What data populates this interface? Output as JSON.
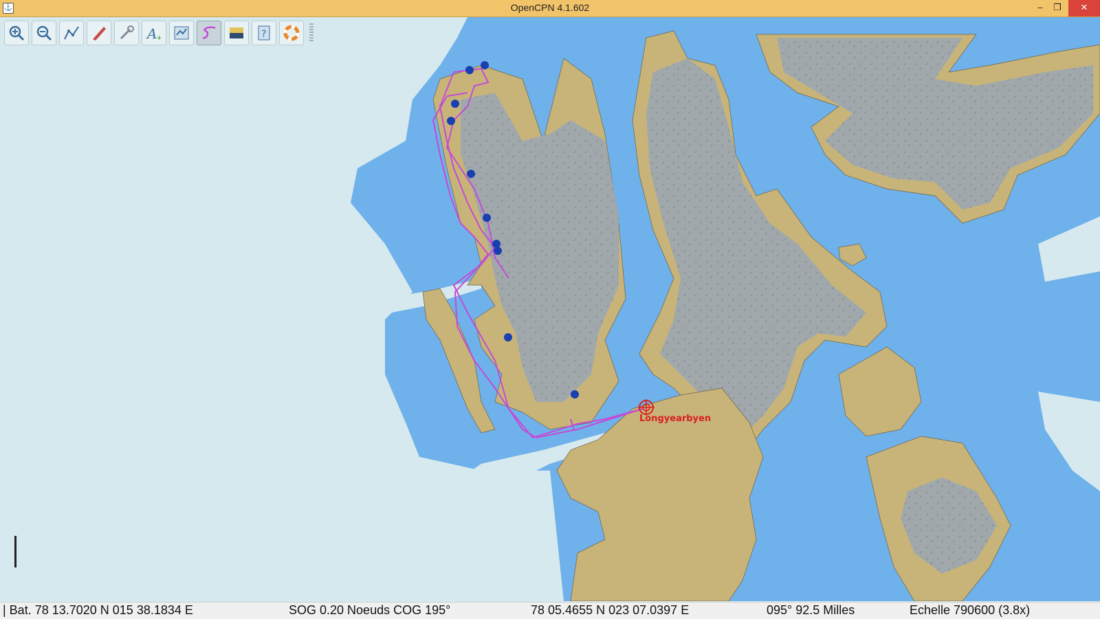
{
  "window": {
    "title": "OpenCPN 4.1.602",
    "app_icon": "chart-app-icon",
    "controls": [
      "minimize",
      "restore",
      "close"
    ]
  },
  "toolbar": {
    "tools": [
      {
        "name": "zoom-in-icon",
        "tooltip": ""
      },
      {
        "name": "zoom-out-icon",
        "tooltip": ""
      },
      {
        "name": "route-icon",
        "tooltip": ""
      },
      {
        "name": "ship-icon",
        "tooltip": ""
      },
      {
        "name": "settings-wrench-icon",
        "tooltip": ""
      },
      {
        "name": "text-add-icon",
        "tooltip": ""
      },
      {
        "name": "route-manager-icon",
        "tooltip": ""
      },
      {
        "name": "track-icon",
        "tooltip": ""
      },
      {
        "name": "color-scheme-icon",
        "tooltip": ""
      },
      {
        "name": "help-icon",
        "tooltip": ""
      },
      {
        "name": "mob-lifebuoy-icon",
        "tooltip": ""
      }
    ]
  },
  "map": {
    "place_label": "Longyearbyen",
    "colors": {
      "deep_water": "#d6e9ee",
      "shallow_water": "#6fb1ea",
      "land": "#c8b479",
      "glacier": "#a0a8ab",
      "track": "#c34bd6",
      "place": "#d82020",
      "anchorage": "#1a3fb0"
    },
    "anchorage_count": 11
  },
  "status": {
    "boat": "| Bat. 78 13.7020 N   015 38.1834 E",
    "sog_cog": "SOG 0.20 Noeuds   COG 195°",
    "cursor": "78 05.4655 N   023 07.0397 E",
    "bearing_range": "095°   92.5 Milles",
    "scale": "Echelle 790600 (3.8x)"
  }
}
